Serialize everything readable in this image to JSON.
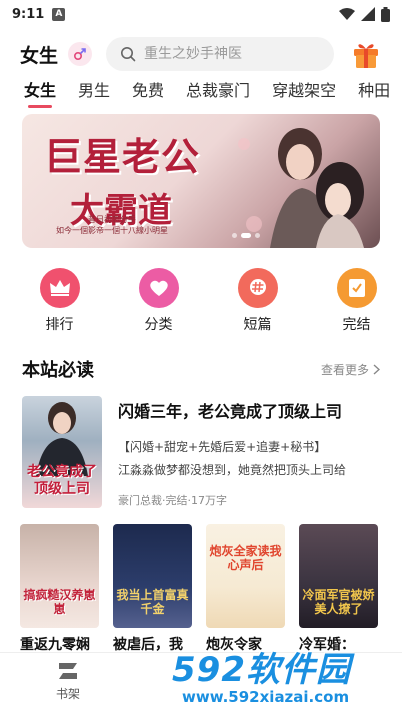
{
  "status_bar": {
    "time": "9:11",
    "notification_badge": "A"
  },
  "header": {
    "title": "女生",
    "search_placeholder": "重生之妙手神医"
  },
  "tabs": [
    {
      "label": "女生",
      "active": true
    },
    {
      "label": "男生",
      "active": false
    },
    {
      "label": "免费",
      "active": false
    },
    {
      "label": "总裁豪门",
      "active": false
    },
    {
      "label": "穿越架空",
      "active": false
    },
    {
      "label": "种田",
      "active": false
    }
  ],
  "banner": {
    "title_line1": "巨星老公",
    "title_line2": "太霸道",
    "subtitle_line1": "昔日初恋分手",
    "subtitle_line2": "如今一個影帝一個十八線小明星",
    "page_count": 3,
    "active_index": 1
  },
  "quick_links": [
    {
      "label": "排行",
      "icon": "crown-icon",
      "color": "#f0516e"
    },
    {
      "label": "分类",
      "icon": "heart-icon",
      "color": "#ec5ca4"
    },
    {
      "label": "短篇",
      "icon": "hash-bubble-icon",
      "color": "#f26a5c"
    },
    {
      "label": "完结",
      "icon": "book-check-icon",
      "color": "#f59a32"
    }
  ],
  "section": {
    "title": "本站必读",
    "more_label": "查看更多"
  },
  "featured_book": {
    "cover_text": "老公竟成了顶级上司",
    "title": "闪婚三年，老公竟成了顶级上司",
    "tags": "【闪婚+甜宠+先婚后爱+追妻+秘书】",
    "description": "江淼淼做梦都没想到，她竟然把顶头上司给",
    "info": "豪门总裁·完结·17万字"
  },
  "books": [
    {
      "title": "重返九零娴",
      "cover_text": "搞疯糙汉养崽崽",
      "bg": "#e9d6cf",
      "text_color": "#c2243b"
    },
    {
      "title": "被虐后，我",
      "cover_text": "我当上首富真千金",
      "bg": "#2c3d6b",
      "text_color": "#f3d26b"
    },
    {
      "title": "炮灰令家",
      "cover_text": "炮灰全家读我心声后",
      "bg": "#f6ead3",
      "text_color": "#e0452e"
    },
    {
      "title": "冷军婚：",
      "cover_text": "冷面军官被娇美人撩了",
      "bg": "#3a3340",
      "text_color": "#f2c64c"
    }
  ],
  "bottom_nav": {
    "shelf_label": "书架"
  },
  "watermark": {
    "brand": "592软件园",
    "url": "www.592xiazai.com"
  },
  "colors": {
    "accent": "#e84a5f",
    "watermark": "#1a8fe0"
  }
}
